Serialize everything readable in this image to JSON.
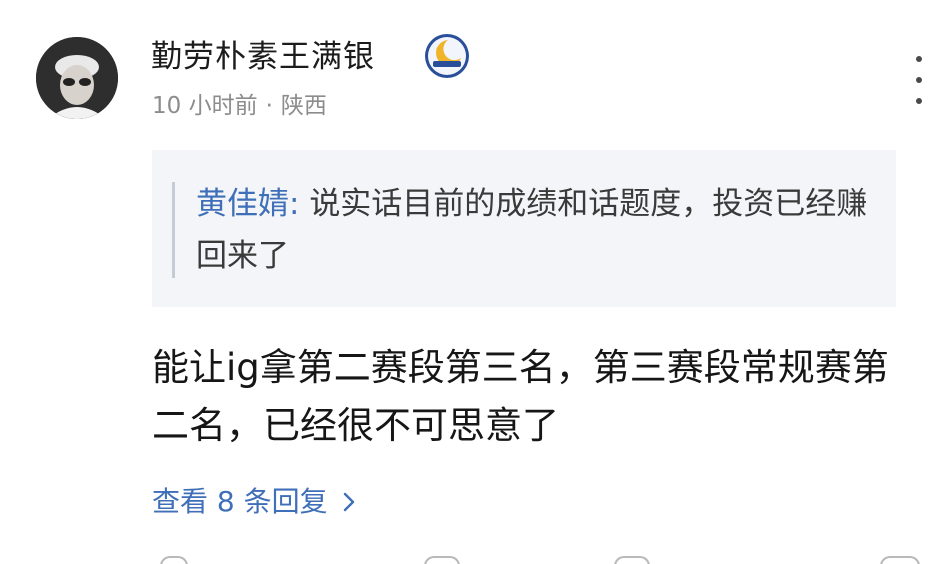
{
  "comment": {
    "author": "勤劳朴素王满银",
    "avatar_icon": "user-avatar-icon",
    "badge_icon": "moon-badge-icon",
    "timestamp": "10 小时前",
    "separator": "·",
    "location": "陕西",
    "more_icon": "more-vertical-icon",
    "quote": {
      "author": "黄佳婧:",
      "text": "说实话目前的成绩和话题度，投资已经赚回来了"
    },
    "body": "能让ig拿第二赛段第三名，第三赛段常规赛第二名，已经很不可思意了",
    "replies_label": "查看 8 条回复",
    "replies_icon": "chevron-right-icon"
  },
  "colors": {
    "link": "#3f6fb8",
    "text": "#161616",
    "muted": "#8c8c8c",
    "quote_bg": "#f3f5f8"
  }
}
